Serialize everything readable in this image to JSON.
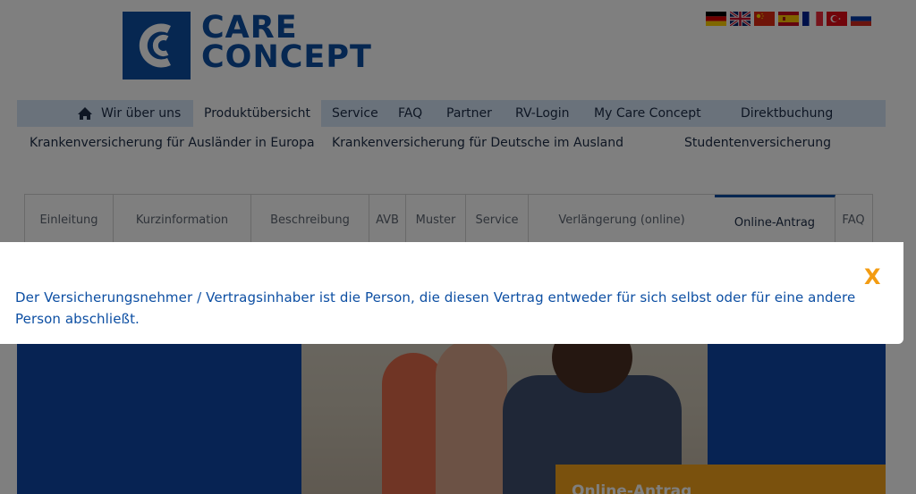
{
  "header": {
    "logo_line1": "CARE",
    "logo_line2": "CONCEPT",
    "language_flags": [
      "de-flag-icon",
      "gb-flag-icon",
      "cn-flag-icon",
      "es-flag-icon",
      "fr-flag-icon",
      "tr-flag-icon",
      "ru-flag-icon"
    ]
  },
  "mainnav": {
    "home_icon": "home-icon",
    "items": [
      "Wir über uns",
      "Produktübersicht",
      "Service",
      "FAQ",
      "Partner",
      "RV-Login",
      "My Care Concept",
      "Direktbuchung"
    ]
  },
  "subnav": {
    "items": [
      "Krankenversicherung für Ausländer in Europa",
      "Krankenversicherung für Deutsche im Ausland",
      "Studentenversicherung"
    ]
  },
  "tabs": {
    "items": [
      "Einleitung",
      "Kurzinformation",
      "Beschreibung",
      "AVB",
      "Muster",
      "Service",
      "Verlängerung (online)",
      "Online-Antrag",
      "FAQ"
    ],
    "active": "Online-Antrag"
  },
  "hero": {
    "cta_text": "Online-Antrag"
  },
  "modal": {
    "close_label": "X",
    "text": "Der Versicherungsnehmer / Vertragsinhaber ist die Person, die diesen Vertrag entweder für sich selbst oder für eine andere Person abschließt."
  },
  "colors": {
    "brand_blue": "#0d4fa3",
    "accent_orange": "#f39c12",
    "nav_bg": "#d5e4f7"
  }
}
